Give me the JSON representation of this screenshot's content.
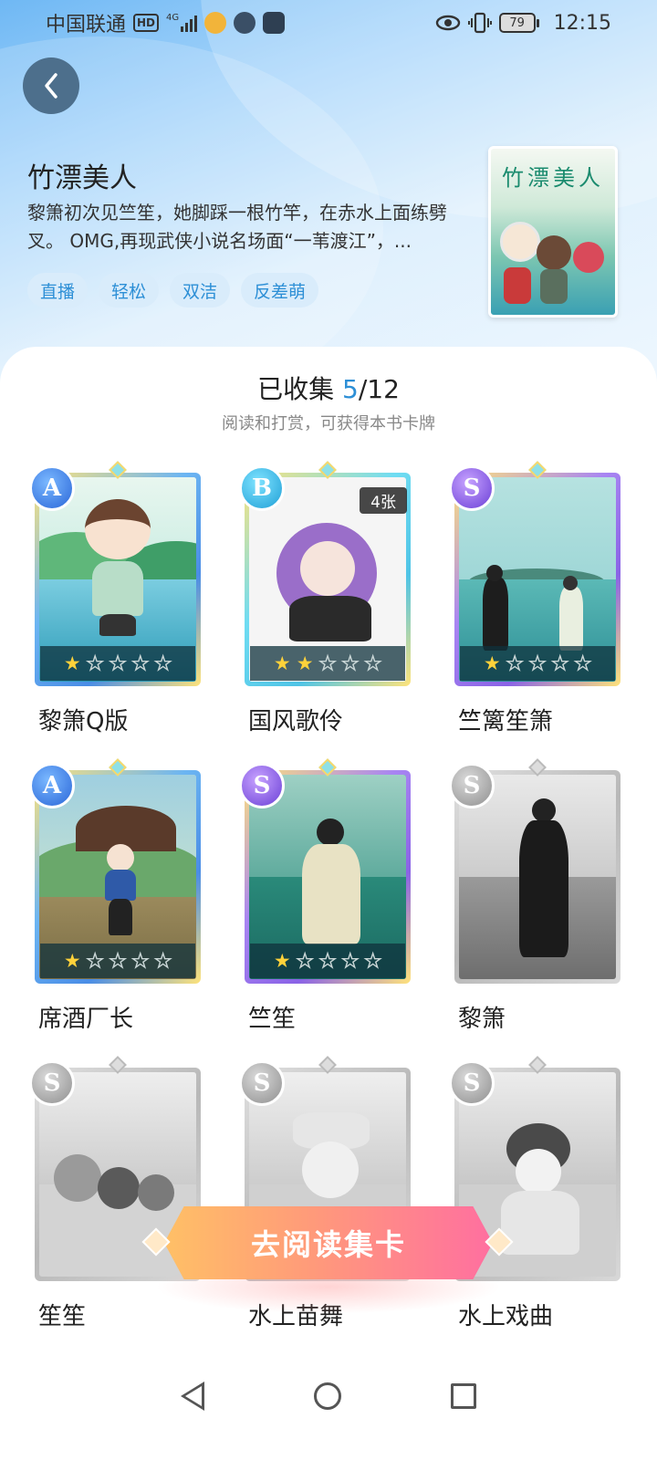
{
  "status_bar": {
    "carrier": "中国联通",
    "hd": "HD",
    "network": "4G",
    "battery": "79",
    "time": "12:15"
  },
  "book": {
    "title": "竹漂美人",
    "description": "黎箫初次见竺笙，她脚踩一根竹竿，在赤水上面练劈叉。 OMG,再现武侠小说名场面“一苇渡江”，...",
    "tags": [
      "直播",
      "轻松",
      "双洁",
      "反差萌"
    ],
    "cover_title": "竹漂美人"
  },
  "collection": {
    "label": "已收集",
    "collected": "5",
    "total": "/12",
    "subtitle": "阅读和打赏，可获得本书卡牌"
  },
  "cards": [
    {
      "name": "黎箫Q版",
      "rank": "A",
      "stars": 5,
      "filled": 1,
      "owned": true
    },
    {
      "name": "国风歌伶",
      "rank": "B",
      "stars": 5,
      "filled": 2,
      "owned": true,
      "count": "4张"
    },
    {
      "name": "竺篱笙箫",
      "rank": "S",
      "stars": 5,
      "filled": 1,
      "owned": true
    },
    {
      "name": "席酒厂长",
      "rank": "A",
      "stars": 5,
      "filled": 1,
      "owned": true
    },
    {
      "name": "竺笙",
      "rank": "S",
      "stars": 5,
      "filled": 1,
      "owned": true
    },
    {
      "name": "黎箫",
      "rank": "S",
      "owned": false
    },
    {
      "name": "笙笙",
      "rank": "S",
      "owned": false
    },
    {
      "name": "水上苗舞",
      "rank": "S",
      "owned": false
    },
    {
      "name": "水上戏曲",
      "rank": "S",
      "owned": false
    }
  ],
  "cta": {
    "label": "去阅读集卡"
  },
  "icons": {
    "back": "chevron-left-icon",
    "eye": "eye-icon",
    "vibrate": "vibrate-icon"
  }
}
